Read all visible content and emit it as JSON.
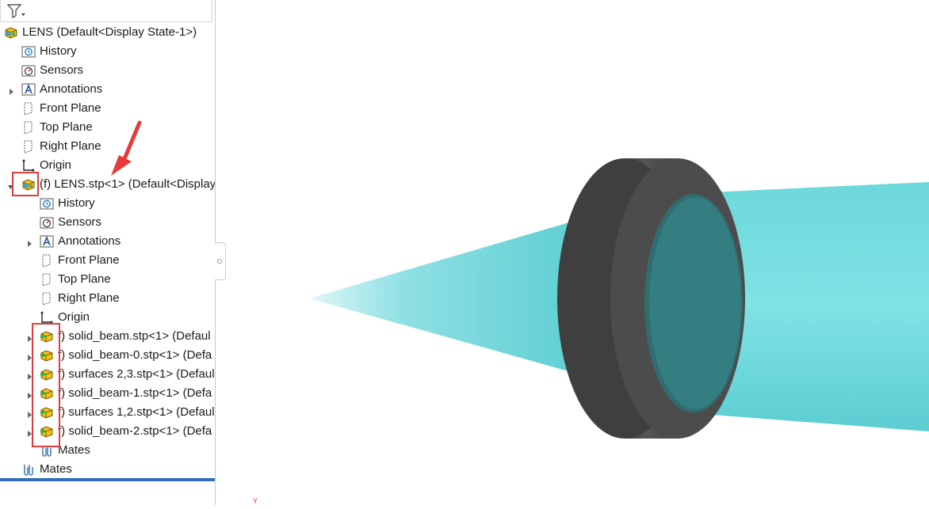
{
  "tree": {
    "root": "LENS  (Default<Display State-1>)",
    "root_items": [
      "History",
      "Sensors",
      "Annotations",
      "Front Plane",
      "Top Plane",
      "Right Plane",
      "Origin"
    ],
    "sub_assembly": "(f) LENS.stp<1> (Default<Display",
    "sub_items": [
      "History",
      "Sensors",
      "Annotations",
      "Front Plane",
      "Top Plane",
      "Right Plane",
      "Origin"
    ],
    "parts": [
      "f) solid_beam.stp<1> (Defaul",
      "f) solid_beam-0.stp<1> (Defa",
      "f) surfaces 2,3.stp<1> (Defaul",
      "f) solid_beam-1.stp<1> (Defa",
      "f) surfaces 1,2.stp<1> (Defaul",
      "f) solid_beam-2.stp<1> (Defa"
    ],
    "sub_mates": "Mates",
    "root_mates": "Mates"
  },
  "icons": {
    "filter": "funnel-filter-icon",
    "assembly": "assembly-icon",
    "history": "history-icon",
    "sensors": "sensors-icon",
    "annotations": "annotations-icon",
    "plane": "plane-icon",
    "origin": "origin-icon",
    "part": "part-icon",
    "mates": "mates-icon"
  },
  "colors": {
    "highlight": "#e03c3c",
    "beam": "#5fcfd3",
    "lens_body": "#4a4a4a",
    "selection_bar": "#2f6db5"
  },
  "viewport": {
    "triad_label": "Y"
  }
}
